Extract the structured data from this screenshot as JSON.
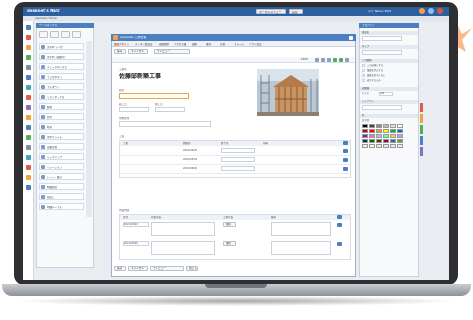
{
  "app": {
    "brand": "desknet's NEO",
    "breadcrumb": "AppSuite / Portal",
    "top_buttons": [
      "ポータルメニュー",
      "設定"
    ],
    "user_text": "メモ Tetsuo 2021"
  },
  "toolbox": {
    "title": "ツールボックス",
    "items": [
      "文字列（一行）",
      "文字列（複数行）",
      "チェックボックス",
      "ラジオボタン",
      "プルダウン",
      "リストボックス",
      "数値",
      "日付",
      "時刻",
      "添付ファイル",
      "自動計算",
      "ルックアップ",
      "リレーション",
      "レーン・集計",
      "明細部品",
      "見出し",
      "明細テーブル"
    ]
  },
  "editor": {
    "app_name": "AppSuite 工務管理",
    "tabs": [
      "部品デザイン",
      "データ一覧設定",
      "画面配置",
      "アクセス権",
      "通知",
      "書式",
      "計算",
      "フォーム",
      "アプリ設定"
    ],
    "action_buttons": [
      "保存",
      "キャンセル",
      "プレビュー"
    ],
    "zoom": "100%",
    "section_label": "工事名",
    "project_title": "佐藤邸新築工事",
    "field_labels": [
      "施主",
      "着工日",
      "竣工日",
      "現場住所"
    ],
    "table_headers": [
      "工程",
      "開始日",
      "終了日",
      "担当"
    ],
    "table_dates": [
      "2021/04/01",
      "2021/05/01",
      "2021/06/01"
    ],
    "detail_headers": [
      "日付",
      "作業内容",
      "工事写真",
      "備考"
    ],
    "detail_dates": [
      "2021/04/20",
      "2021/05/05"
    ],
    "detail_button": "選択",
    "bottom_buttons": [
      "保存",
      "キャンセル",
      "プレビュー",
      "閉じる"
    ]
  },
  "properties": {
    "title": "プロパティ",
    "sections": [
      "部品名",
      "タイプ",
      "入力制限",
      "初期値",
      "レイアウト",
      "色"
    ],
    "option_labels": [
      "入力必須にする",
      "重複を禁止する",
      "編集を許可しない",
      "表示するのみ"
    ],
    "font_label": "文字色",
    "size_label": "サイズ",
    "width_value": "100",
    "colors": [
      "#000000",
      "#444444",
      "#888888",
      "#bbbbbb",
      "#e0e0e0",
      "#ffffff",
      "#c00000",
      "#ff0000",
      "#ff9900",
      "#ffff00",
      "#00b050",
      "#0070c0",
      "#7030a0",
      "#ff66cc",
      "#99ccff",
      "#66ff99",
      "#ffcc66",
      "#cc99ff",
      "#003366",
      "#006600",
      "#663300",
      "#990033",
      "#336699",
      "#669933",
      "#ffe5e5",
      "#fff2cc",
      "#e2efda",
      "#ddebf7",
      "#ede7f6",
      "#fce4ec"
    ]
  },
  "colors": {
    "accent": "#4a7fc1",
    "title_bar": "#2e5f9e",
    "star": "#f6b47c"
  }
}
